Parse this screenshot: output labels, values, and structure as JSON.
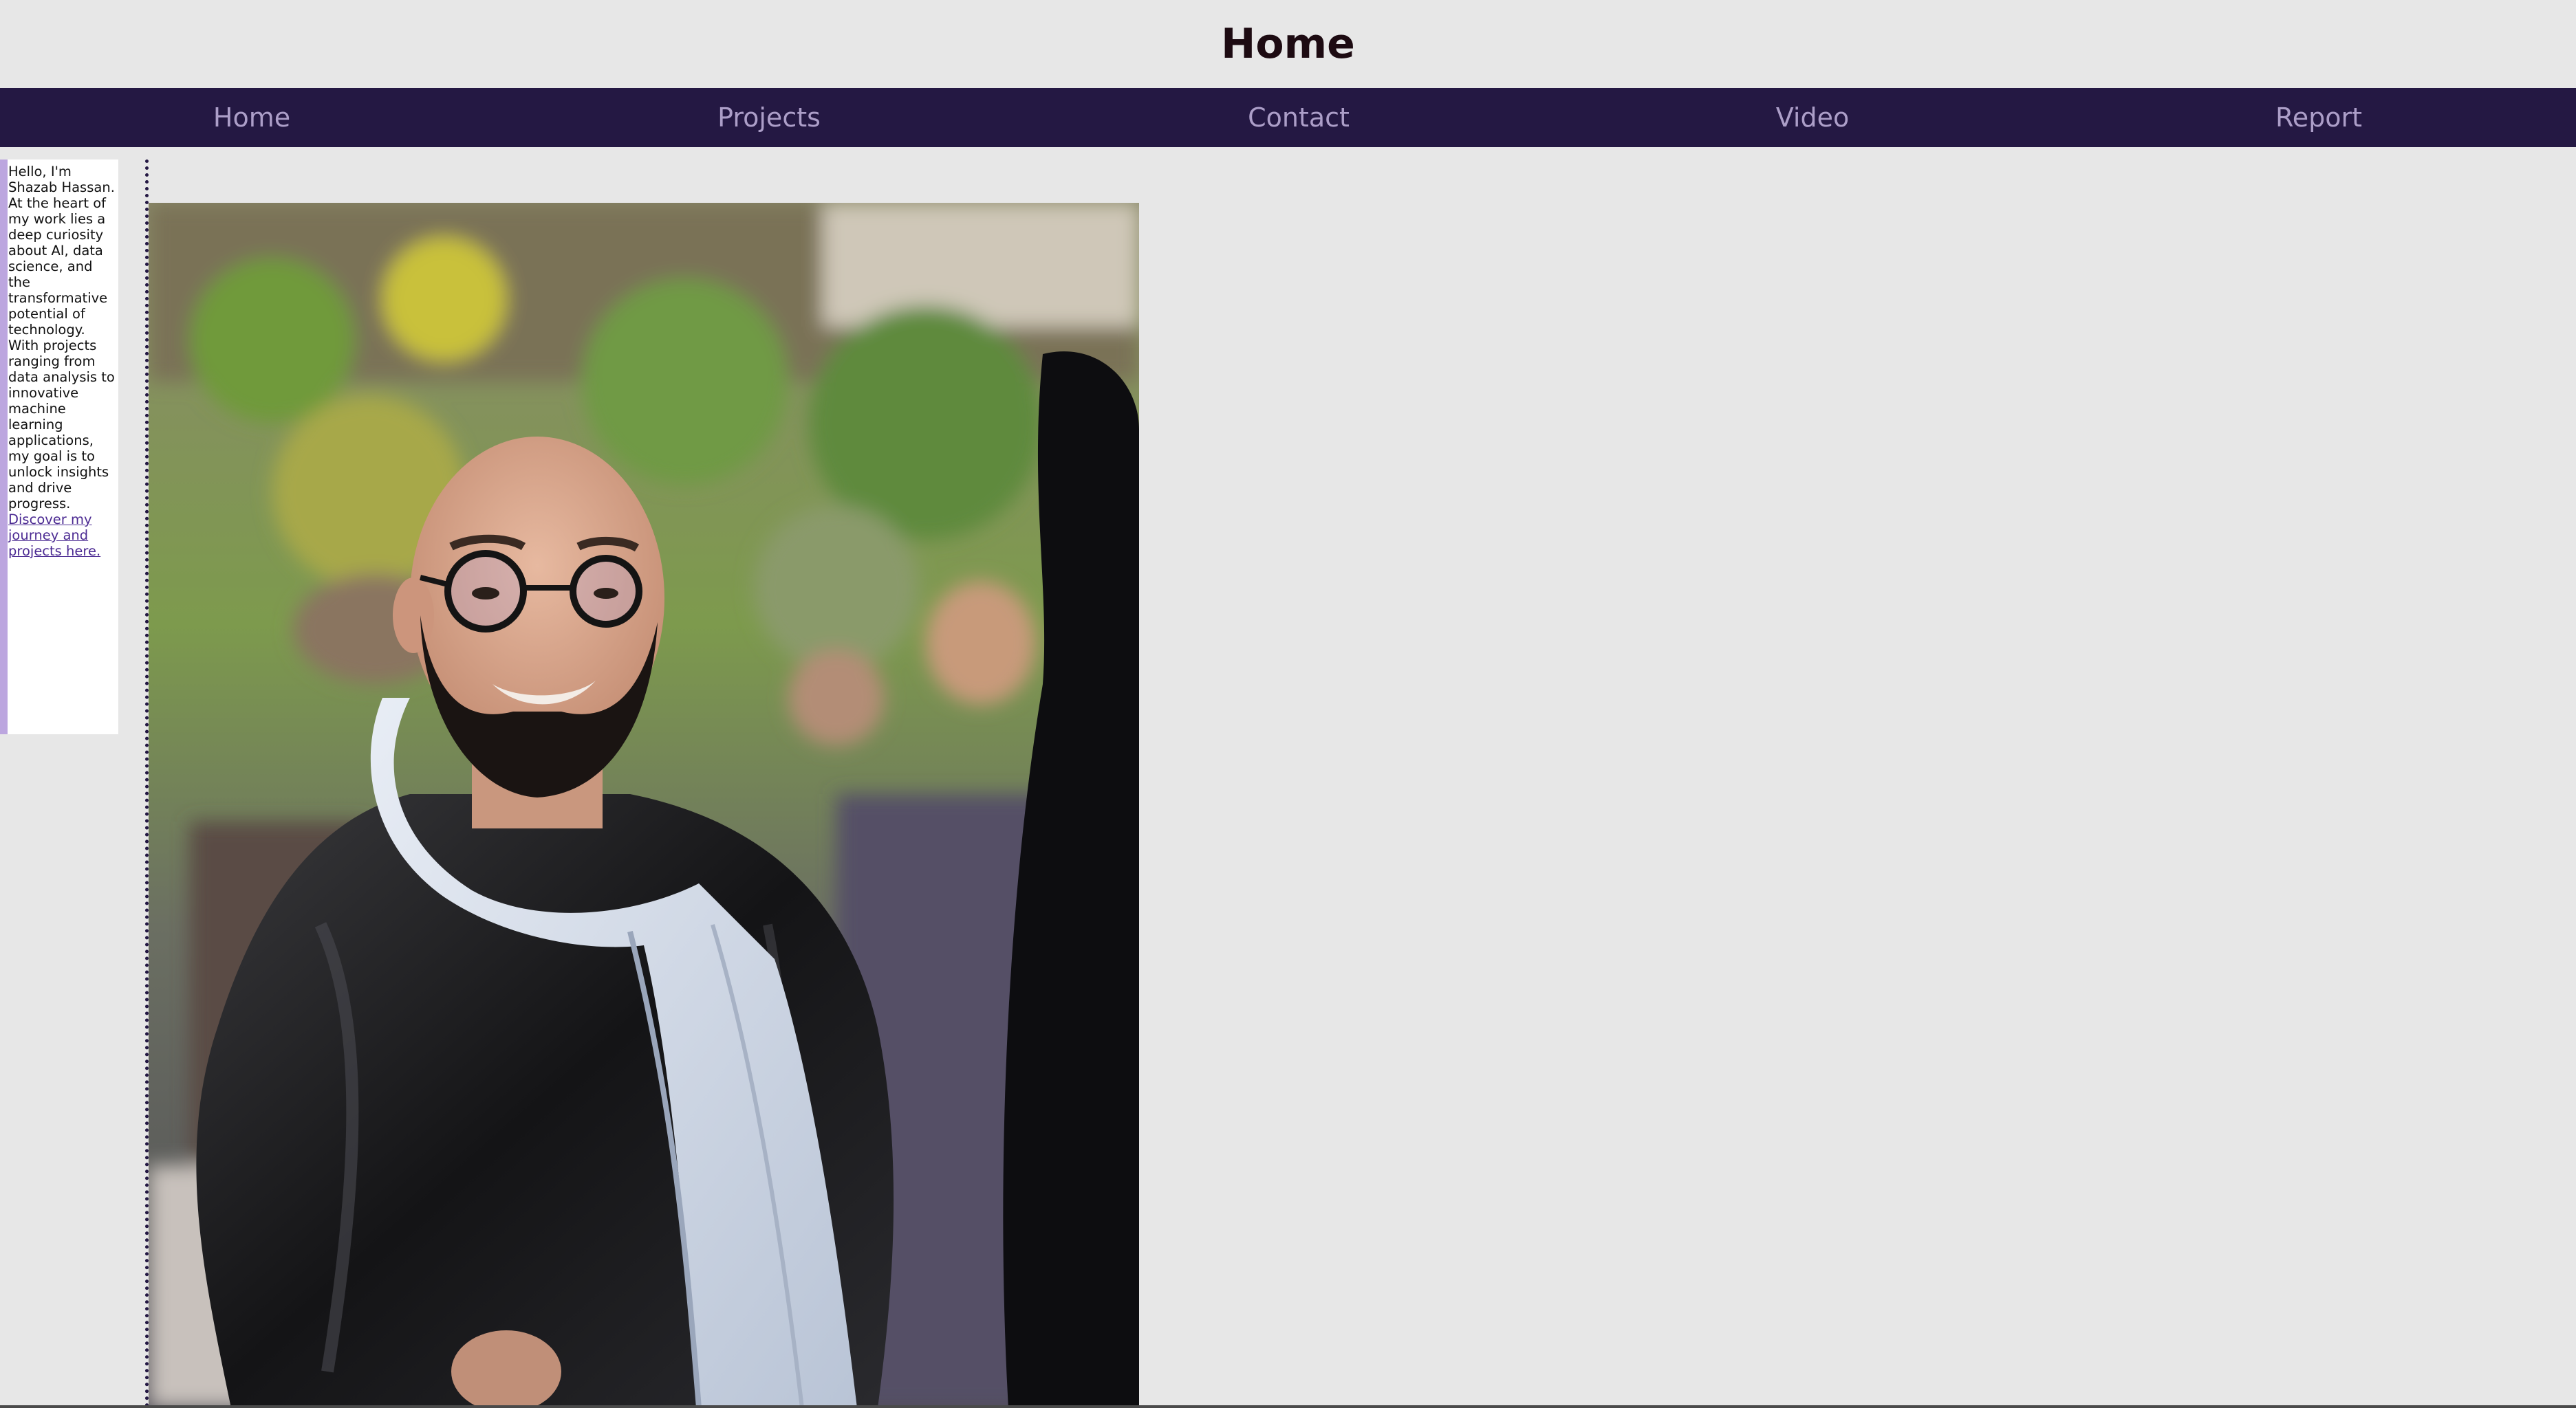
{
  "header": {
    "title": "Home"
  },
  "nav": {
    "items": [
      {
        "label": "Home"
      },
      {
        "label": "Projects"
      },
      {
        "label": "Contact"
      },
      {
        "label": "Video"
      },
      {
        "label": "Report"
      }
    ]
  },
  "intro": {
    "greeting": "Hello, I'm Shazab Hassan.",
    "body": "At the heart of my work lies a deep curiosity about AI, data science, and the transformative potential of technology. With projects ranging from data analysis to innovative machine learning applications, my goal is to unlock insights and drive progress.",
    "link_text": "Discover my journey and projects here."
  },
  "colors": {
    "page_background": "#e7e7e7",
    "nav_background": "#241843",
    "nav_text": "#ac9ec8",
    "title_text": "#1d0b12",
    "sidebar_accent": "#bca6df",
    "link": "#4b2a92"
  },
  "photo": {
    "subject": "portrait-photo"
  }
}
